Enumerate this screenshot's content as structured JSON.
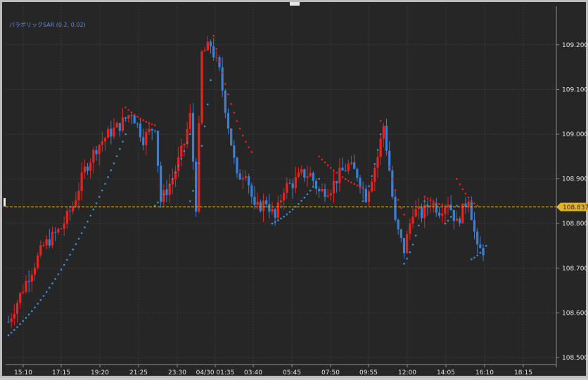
{
  "chart_data": {
    "type": "candlestick",
    "indicator": "パラボリックSAR (0.2, 0.02)",
    "x_ticks": [
      "15:10",
      "17:15",
      "19:20",
      "21:25",
      "23:30",
      "04/30 01:35",
      "03:40",
      "05:45",
      "07:50",
      "09:55",
      "12:00",
      "14:05",
      "16:10",
      "18:15"
    ],
    "y_ticks": [
      "108.500",
      "108.600",
      "108.700",
      "108.800",
      "108.900",
      "109.000",
      "109.100",
      "109.200"
    ],
    "ylim": [
      108.5,
      109.24
    ],
    "current_price": "108.837",
    "grid": true,
    "colors": {
      "up": "#e8231f",
      "down": "#3a7fd5",
      "sar_up": "#3a8fd9",
      "sar_down": "#e8231f",
      "price_line": "#e6b422",
      "background": "#262626",
      "grid": "#3a3a3a"
    },
    "price_path": [
      [
        0,
        108.58
      ],
      [
        6,
        108.67
      ],
      [
        12,
        108.75
      ],
      [
        18,
        108.79
      ],
      [
        22,
        108.84
      ],
      [
        26,
        108.92
      ],
      [
        30,
        108.97
      ],
      [
        34,
        109.0
      ],
      [
        38,
        109.02
      ],
      [
        42,
        109.05
      ],
      [
        46,
        108.99
      ],
      [
        50,
        109.02
      ],
      [
        52,
        108.85
      ],
      [
        56,
        108.9
      ],
      [
        60,
        108.98
      ],
      [
        62,
        109.04
      ],
      [
        64,
        108.84
      ],
      [
        66,
        109.18
      ],
      [
        69,
        109.2
      ],
      [
        72,
        109.14
      ],
      [
        75,
        109.02
      ],
      [
        78,
        108.9
      ],
      [
        81,
        108.92
      ],
      [
        84,
        108.83
      ],
      [
        88,
        108.85
      ],
      [
        91,
        108.81
      ],
      [
        94,
        108.88
      ],
      [
        97,
        108.89
      ],
      [
        100,
        108.91
      ],
      [
        103,
        108.91
      ],
      [
        106,
        108.87
      ],
      [
        110,
        108.88
      ],
      [
        113,
        108.91
      ],
      [
        116,
        108.93
      ],
      [
        119,
        108.91
      ],
      [
        122,
        108.86
      ],
      [
        126,
        108.95
      ],
      [
        128,
        109.02
      ],
      [
        130,
        108.92
      ],
      [
        132,
        108.8
      ],
      [
        135,
        108.74
      ],
      [
        138,
        108.83
      ],
      [
        141,
        108.82
      ],
      [
        144,
        108.85
      ],
      [
        147,
        108.83
      ],
      [
        150,
        108.85
      ],
      [
        153,
        108.8
      ],
      [
        157,
        108.86
      ],
      [
        160,
        108.74
      ]
    ],
    "sar_segments": [
      {
        "trend": "up",
        "from": [
          0,
          108.55
        ],
        "to": [
          40,
          109.0
        ]
      },
      {
        "trend": "down",
        "from": [
          40,
          109.06
        ],
        "to": [
          50,
          109.02
        ]
      },
      {
        "trend": "up",
        "from": [
          50,
          108.84
        ],
        "to": [
          62,
          109.0
        ]
      },
      {
        "trend": "up",
        "from": [
          62,
          108.85
        ],
        "to": [
          70,
          109.18
        ]
      },
      {
        "trend": "down",
        "from": [
          70,
          109.22
        ],
        "to": [
          83,
          108.96
        ]
      },
      {
        "trend": "up",
        "from": [
          90,
          108.8
        ],
        "to": [
          106,
          108.9
        ]
      },
      {
        "trend": "down",
        "from": [
          106,
          108.95
        ],
        "to": [
          121,
          108.88
        ]
      },
      {
        "trend": "up",
        "from": [
          121,
          108.85
        ],
        "to": [
          127,
          109.0
        ]
      },
      {
        "trend": "down",
        "from": [
          127,
          109.03
        ],
        "to": [
          135,
          108.82
        ]
      },
      {
        "trend": "up",
        "from": [
          135,
          108.71
        ],
        "to": [
          142,
          108.85
        ]
      },
      {
        "trend": "down",
        "from": [
          142,
          108.86
        ],
        "to": [
          149,
          108.84
        ]
      },
      {
        "trend": "up",
        "from": [
          149,
          108.8
        ],
        "to": [
          153,
          108.84
        ]
      },
      {
        "trend": "down",
        "from": [
          153,
          108.9
        ],
        "to": [
          160,
          108.84
        ]
      },
      {
        "trend": "up",
        "from": [
          158,
          108.72
        ],
        "to": [
          163,
          108.75
        ]
      }
    ],
    "candle_count": 163,
    "seed": 7
  }
}
